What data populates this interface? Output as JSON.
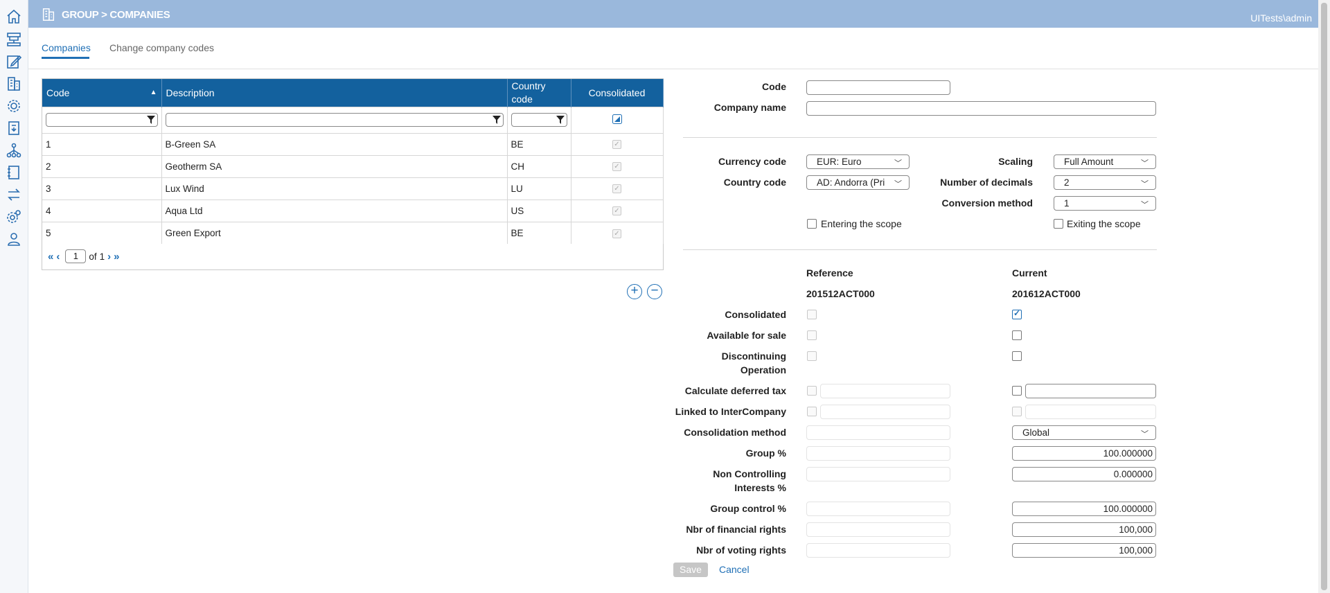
{
  "header": {
    "title": "GROUP > COMPANIES",
    "user": "UITests\\admin"
  },
  "sidebar": {
    "icons": [
      "home-icon",
      "hierarchy-icon",
      "edit-icon",
      "building-icon",
      "gear-cog-icon",
      "report-icon",
      "org-chart-icon",
      "book-icon",
      "transfer-icon",
      "settings-icon",
      "user-icon"
    ]
  },
  "tabs": {
    "companies": "Companies",
    "change_codes": "Change company codes"
  },
  "grid": {
    "headers": {
      "code": "Code",
      "description": "Description",
      "country_code": "Country code",
      "consolidated": "Consolidated"
    },
    "rows": [
      {
        "code": "1",
        "description": "B-Green SA",
        "country": "BE"
      },
      {
        "code": "2",
        "description": "Geotherm SA",
        "country": "CH"
      },
      {
        "code": "3",
        "description": "Lux Wind",
        "country": "LU"
      },
      {
        "code": "4",
        "description": "Aqua Ltd",
        "country": "US"
      },
      {
        "code": "5",
        "description": "Green Export",
        "country": "BE"
      }
    ],
    "pager": {
      "page": "1",
      "of_label": "of",
      "total": "1"
    }
  },
  "form": {
    "code_label": "Code",
    "company_name_label": "Company name",
    "currency_label": "Currency code",
    "currency_value": "EUR: Euro",
    "country_label": "Country code",
    "country_value": "AD: Andorra (Pri",
    "scaling_label": "Scaling",
    "scaling_value": "Full Amount",
    "decimals_label": "Number of decimals",
    "decimals_value": "2",
    "conversion_label": "Conversion method",
    "conversion_value": "1",
    "entering_scope": "Entering the scope",
    "exiting_scope": "Exiting the scope",
    "reference_label": "Reference",
    "current_label": "Current",
    "reference_code": "201512ACT000",
    "current_code": "201612ACT000",
    "consolidated_label": "Consolidated",
    "available_label": "Available for sale",
    "discontinuing_label1": "Discontinuing",
    "discontinuing_label2": "Operation",
    "deferred_label": "Calculate deferred tax",
    "linked_label": "Linked to InterCompany",
    "method_label": "Consolidation method",
    "method_value": "Global",
    "group_pct_label": "Group %",
    "group_pct_value": "100.000000",
    "nci_label1": "Non Controlling",
    "nci_label2": "Interests %",
    "nci_value": "0.000000",
    "control_label": "Group control %",
    "control_value": "100.000000",
    "fin_rights_label": "Nbr of financial rights",
    "fin_rights_value": "100,000",
    "vote_rights_label": "Nbr of voting rights",
    "vote_rights_value": "100,000",
    "save": "Save",
    "cancel": "Cancel"
  }
}
